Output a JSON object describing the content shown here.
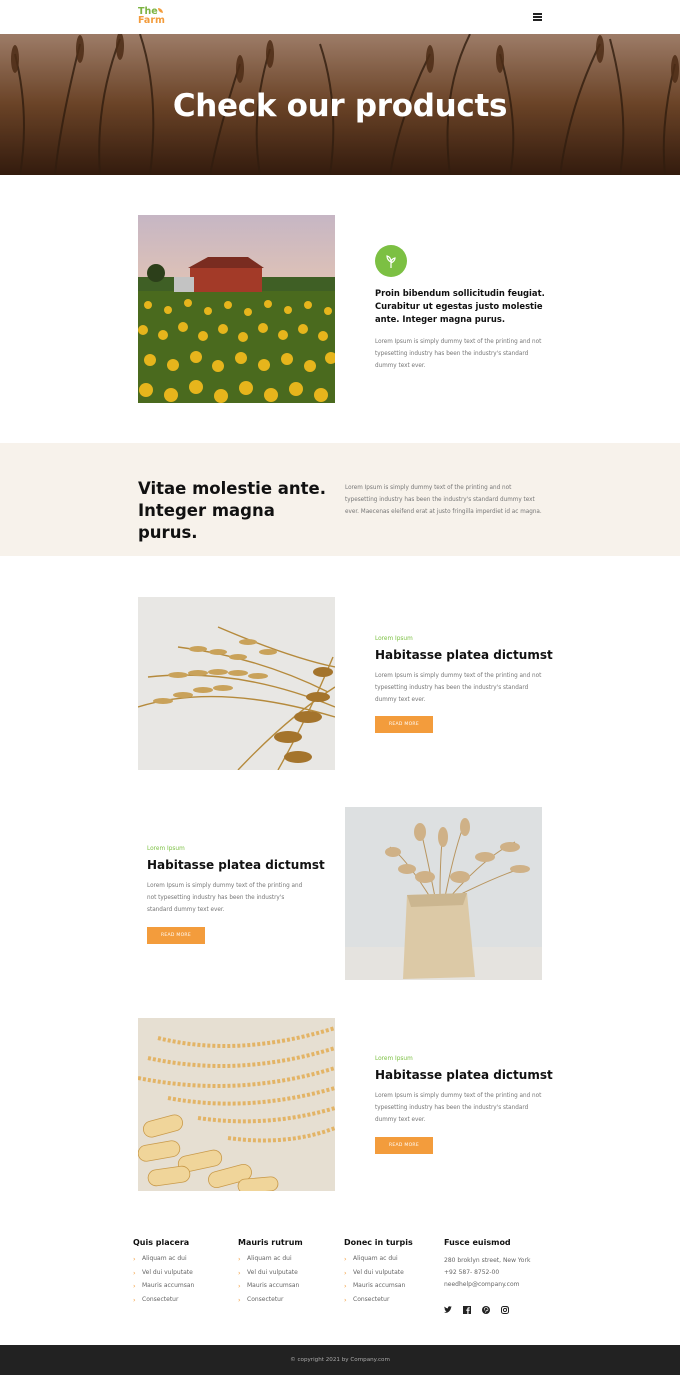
{
  "header": {
    "logo_line1": "The",
    "logo_line2": "Farm",
    "menu_icon": "hamburger-menu-icon"
  },
  "hero": {
    "title": "Check our products"
  },
  "intro": {
    "badge_icon": "plant-sprout-icon",
    "title": "Proin bibendum sollicitudin feugiat. Curabitur ut egestas justo molestie ante. Integer magna purus.",
    "text": "Lorem Ipsum is simply dummy text of the printing and not typesetting industry has been the industry's standard dummy text ever."
  },
  "band": {
    "title_line1": "Vitae molestie ante.",
    "title_line2": "Integer magna purus.",
    "text": "Lorem Ipsum is simply dummy text of the printing and not typesetting industry has been the industry's standard dummy text ever. Maecenas eleifend erat at justo fringilla imperdiet id ac magna."
  },
  "products": [
    {
      "kicker": "Lorem Ipsum",
      "title": "Habitasse platea dictumst",
      "text": "Lorem Ipsum is simply dummy text of the printing and not typesetting industry has been the industry's standard dummy text ever.",
      "button": "READ MORE"
    },
    {
      "kicker": "Lorem Ipsum",
      "title": "Habitasse platea dictumst",
      "text": "Lorem Ipsum is simply dummy text of the printing and not typesetting industry has been the industry's standard dummy text ever.",
      "button": "READ MORE"
    },
    {
      "kicker": "Lorem Ipsum",
      "title": "Habitasse platea dictumst",
      "text": "Lorem Ipsum is simply dummy text of the printing and not typesetting industry has been the industry's standard dummy text ever.",
      "button": "READ MORE"
    }
  ],
  "footer": {
    "columns": [
      {
        "title": "Quis placera",
        "items": [
          "Aliquam ac dui",
          "Vel dui vulputate",
          "Mauris accumsan",
          "Consectetur"
        ]
      },
      {
        "title": "Mauris rutrum",
        "items": [
          "Aliquam ac dui",
          "Vel dui vulputate",
          "Mauris accumsan",
          "Consectetur"
        ]
      },
      {
        "title": "Donec in turpis",
        "items": [
          "Aliquam ac dui",
          "Vel dui vulputate",
          "Mauris accumsan",
          "Consectetur"
        ]
      }
    ],
    "contact": {
      "title": "Fusce euismod",
      "address": "280 broklyn street, New York",
      "phone": "+92 587- 8752-00",
      "email": "needhelp@company.com"
    },
    "social_icons": [
      "twitter-icon",
      "facebook-icon",
      "pinterest-icon",
      "instagram-icon"
    ],
    "copyright": "© copyright 2021 by Company.com"
  },
  "colors": {
    "accent_green": "#7cc043",
    "accent_orange": "#f39c3c",
    "band_bg": "#f7f2eb",
    "footer_bar": "#222222"
  }
}
